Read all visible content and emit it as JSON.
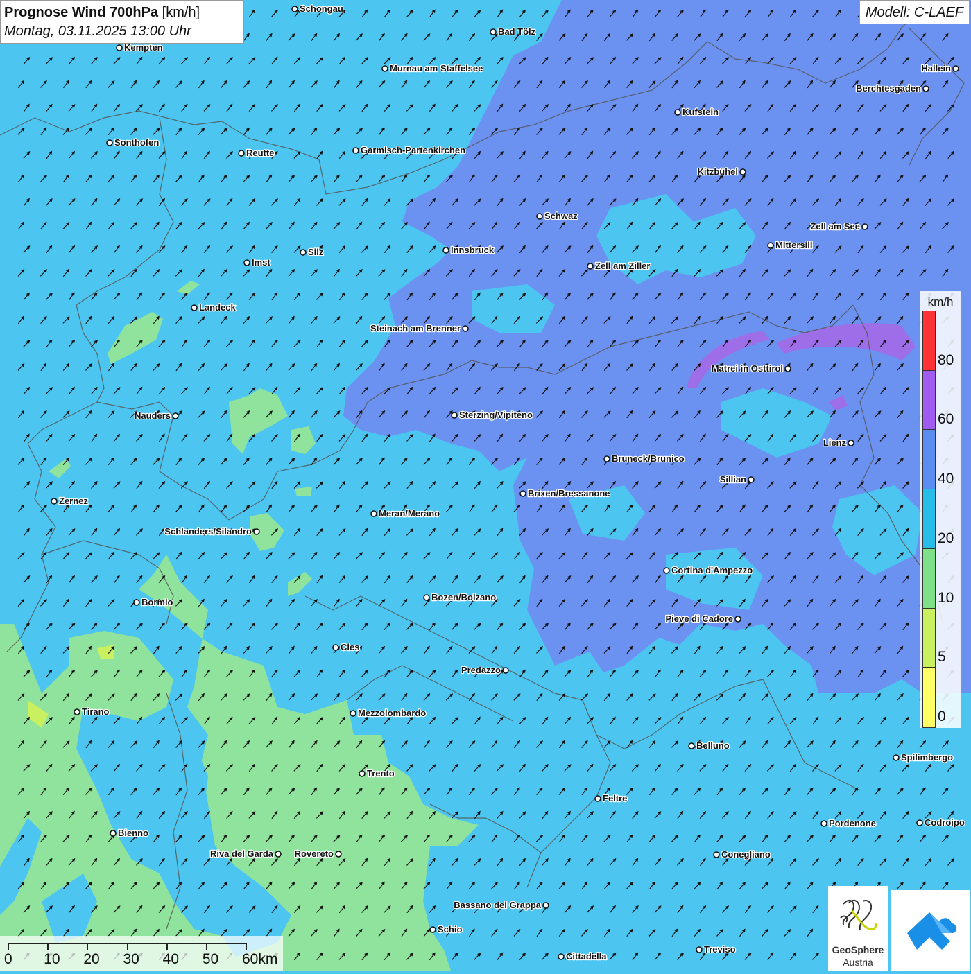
{
  "header": {
    "title_bold": "Prognose Wind 700hPa",
    "title_unit": "[km/h]",
    "datetime": "Montag, 03.11.2025 13:00 Uhr"
  },
  "model_label": "Modell: C-LAEF",
  "legend": {
    "unit": "km/h",
    "classes": [
      {
        "label": "80",
        "color": "#ff3333"
      },
      {
        "label": "60",
        "color": "#a05cf0"
      },
      {
        "label": "40",
        "color": "#5b8df0"
      },
      {
        "label": "20",
        "color": "#28bde8"
      },
      {
        "label": "10",
        "color": "#7fe08a"
      },
      {
        "label": "5",
        "color": "#c8f060"
      },
      {
        "label": "0",
        "color": "#ffff66"
      }
    ]
  },
  "scale": {
    "labels": [
      "0",
      "10",
      "20",
      "30",
      "40",
      "50",
      "60km"
    ]
  },
  "logos": {
    "geosphere_line1": "GeoSphere",
    "geosphere_line2": "Austria"
  },
  "colors": {
    "wind_20_40": "#4cc6f0",
    "wind_40_60": "#6d8ef0",
    "wind_60_80": "#9d6ee8",
    "wind_10_20": "#8fe39c",
    "wind_5_10": "#c8f060",
    "border": "#555555",
    "arrow": "#111111"
  },
  "cities": [
    {
      "name": "Schongau"
    },
    {
      "name": "Bad Tölz"
    },
    {
      "name": "Kempten"
    },
    {
      "name": "Murnau am Staffelsee"
    },
    {
      "name": "Hallein"
    },
    {
      "name": "Berchtesgaden"
    },
    {
      "name": "Kufstein"
    },
    {
      "name": "Sonthofen"
    },
    {
      "name": "Reutte"
    },
    {
      "name": "Garmisch-Partenkirchen"
    },
    {
      "name": "Kitzbühel"
    },
    {
      "name": "Schwaz"
    },
    {
      "name": "Zell am See"
    },
    {
      "name": "Mittersill"
    },
    {
      "name": "Innsbruck"
    },
    {
      "name": "Silz"
    },
    {
      "name": "Imst"
    },
    {
      "name": "Zell am Ziller"
    },
    {
      "name": "Landeck"
    },
    {
      "name": "Steinach am Brenner"
    },
    {
      "name": "Matrei in Osttirol"
    },
    {
      "name": "Nauders"
    },
    {
      "name": "Sterzing/Vipiteno"
    },
    {
      "name": "Lienz"
    },
    {
      "name": "Bruneck/Brunico"
    },
    {
      "name": "Sillian"
    },
    {
      "name": "Brixen/Bressanone"
    },
    {
      "name": "Zernez"
    },
    {
      "name": "Meran/Merano"
    },
    {
      "name": "Schlanders/Silandro"
    },
    {
      "name": "Cortina d'Ampezzo"
    },
    {
      "name": "Bozen/Bolzano"
    },
    {
      "name": "Bormio"
    },
    {
      "name": "Pieve di Cadore"
    },
    {
      "name": "Cles"
    },
    {
      "name": "Predazzo"
    },
    {
      "name": "Tirano"
    },
    {
      "name": "Mezzolombardo"
    },
    {
      "name": "Belluno"
    },
    {
      "name": "Spilimbergo"
    },
    {
      "name": "Trento"
    },
    {
      "name": "Feltre"
    },
    {
      "name": "Pordenone"
    },
    {
      "name": "Codroipo"
    },
    {
      "name": "Bienno"
    },
    {
      "name": "Riva del Garda"
    },
    {
      "name": "Rovereto"
    },
    {
      "name": "Conegliano"
    },
    {
      "name": "Bassano del Grappa"
    },
    {
      "name": "Schio"
    },
    {
      "name": "Treviso"
    },
    {
      "name": "Cittadella"
    }
  ]
}
